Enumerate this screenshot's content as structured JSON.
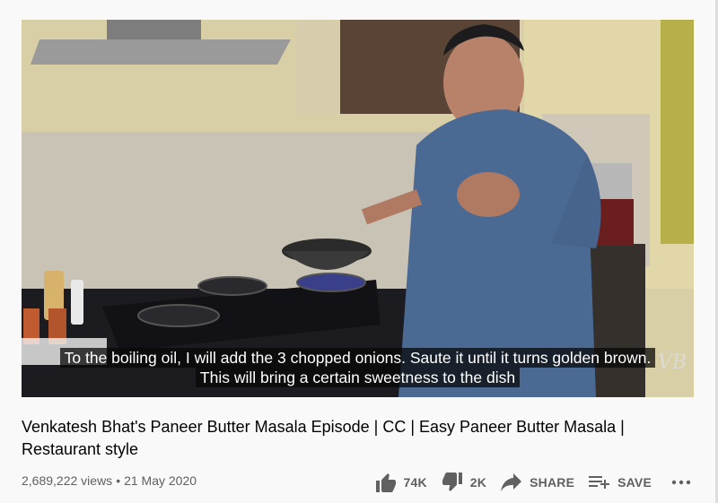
{
  "video": {
    "captions": [
      "To the boiling oil, I will add the 3 chopped onions. Saute it until it turns golden brown.",
      "This will bring a certain sweetness to the dish"
    ]
  },
  "title": "Venkatesh Bhat's Paneer Butter Masala Episode | CC | Easy Paneer Butter Masala | Restaurant style",
  "meta": {
    "views": "2,689,222 views",
    "separator": "•",
    "date": "21 May 2020"
  },
  "actions": {
    "like_count": "74K",
    "dislike_count": "2K",
    "share_label": "SHARE",
    "save_label": "SAVE",
    "more_icon": "more-horiz-icon"
  },
  "colors": {
    "page_bg": "#f9f9f9",
    "text_primary": "#030303",
    "text_secondary": "#606060"
  }
}
